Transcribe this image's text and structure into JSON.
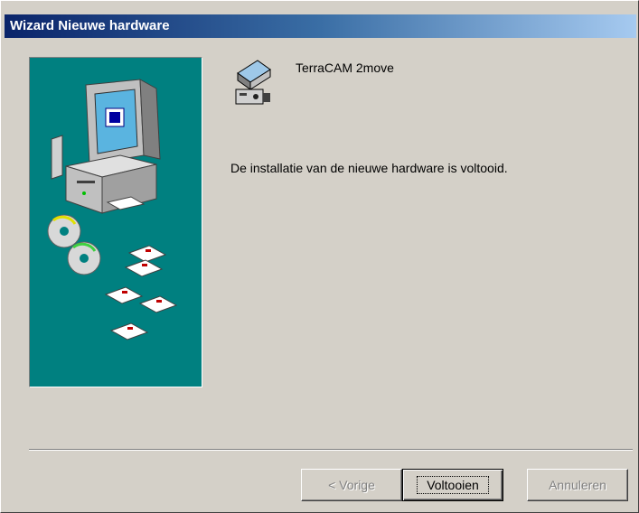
{
  "window": {
    "title": "Wizard Nieuwe hardware"
  },
  "device": {
    "icon": "scanner-camera-icon",
    "name": "TerraCAM 2move"
  },
  "message": "De installatie van de nieuwe hardware is voltooid.",
  "sidebar": {
    "image": "computer-with-disks-illustration",
    "background_color": "#008080"
  },
  "buttons": {
    "back_label": "< Vorige",
    "finish_label": "Voltooien",
    "cancel_label": "Annuleren"
  }
}
